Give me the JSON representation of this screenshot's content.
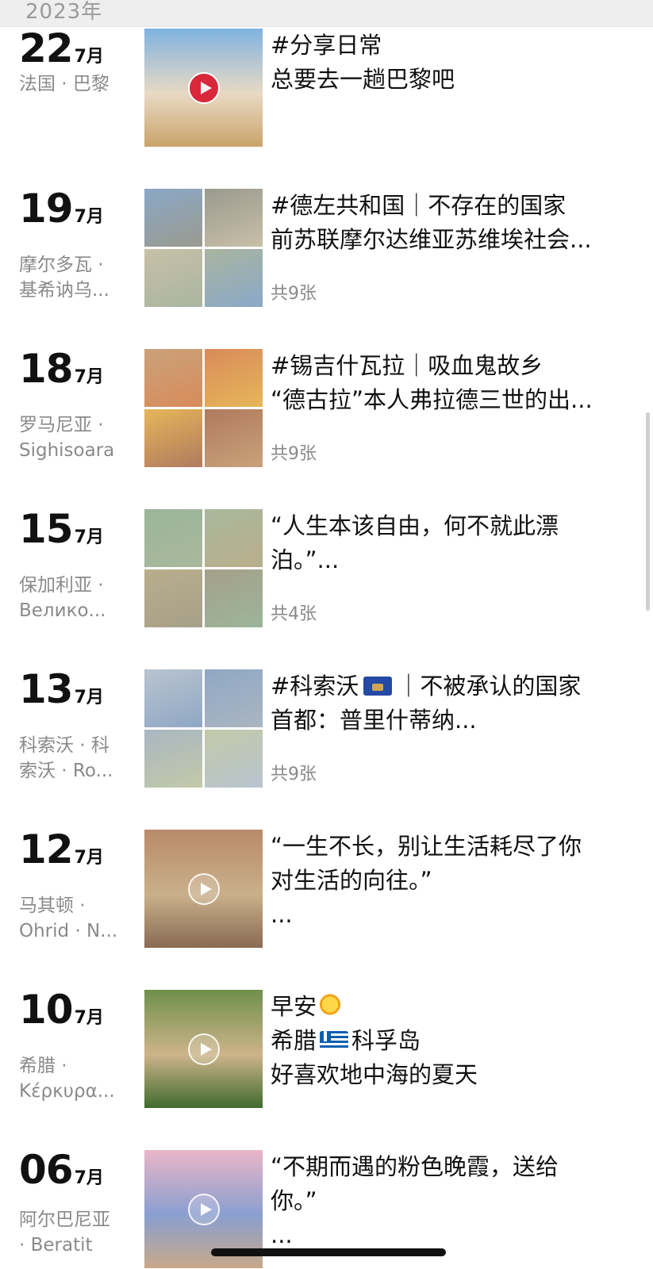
{
  "header": {
    "year": "2023年"
  },
  "entries": [
    {
      "day": "22",
      "month": "7月",
      "location": {
        "line1": "法国 · 巴黎",
        "line2": ""
      },
      "caption": [
        "#分享日常",
        "总要去一趟巴黎吧"
      ],
      "count": "",
      "media": "video",
      "colors": [
        "#7fb3e0",
        "#e9d9c4",
        "#c9a46a"
      ]
    },
    {
      "day": "19",
      "month": "7月",
      "location": {
        "line1": "摩尔多瓦 ·",
        "line2": "基希讷乌..."
      },
      "caption": [
        "#德左共和国｜不存在的国家",
        "前苏联摩尔达维亚苏维埃社会..."
      ],
      "count": "共9张",
      "media": "grid",
      "colors": [
        "#8aa8c8",
        "#9a9a8e",
        "#c8c0a8",
        "#a9b5a0"
      ]
    },
    {
      "day": "18",
      "month": "7月",
      "location": {
        "line1": "罗马尼亚 ·",
        "line2": "Sighisoara"
      },
      "caption": [
        "#锡吉什瓦拉｜吸血鬼故乡",
        "“德古拉”本人弗拉德三世的出..."
      ],
      "count": "共9张",
      "media": "grid",
      "colors": [
        "#c9a27a",
        "#d98b5a",
        "#e6b65a",
        "#b07a5e"
      ]
    },
    {
      "day": "15",
      "month": "7月",
      "location": {
        "line1": "保加利亚 ·",
        "line2": "Велико..."
      },
      "caption": [
        "“人生本该自由，何不就此漂",
        "泊。”..."
      ],
      "count": "共4张",
      "media": "grid",
      "colors": [
        "#9bb59a",
        "#a9b89c",
        "#b9ae8c",
        "#a6a08a"
      ]
    },
    {
      "day": "13",
      "month": "7月",
      "location": {
        "line1": "科索沃 · 科",
        "line2": "索沃 · Ro..."
      },
      "caption": [
        "#科索沃[flag-xk]｜不被承认的国家",
        "首都：普里什蒂纳..."
      ],
      "count": "共9张",
      "media": "grid",
      "colors": [
        "#b9c4cf",
        "#8fa7c4",
        "#aab6c2",
        "#c2c9a8"
      ]
    },
    {
      "day": "12",
      "month": "7月",
      "location": {
        "line1": "马其顿 ·",
        "line2": "Ohrid · N..."
      },
      "caption": [
        "“一生不长，别让生活耗尽了你",
        "对生活的向往。”",
        "..."
      ],
      "count": "",
      "media": "video",
      "colors": [
        "#b98a6a",
        "#c9b08a",
        "#8a6a54"
      ]
    },
    {
      "day": "10",
      "month": "7月",
      "location": {
        "line1": "希腊 ·",
        "line2": "Κέρκυρα..."
      },
      "caption": [
        "早安[sun]",
        "希腊[flag-gr]科孚岛",
        "好喜欢地中海的夏天"
      ],
      "count": "",
      "media": "video",
      "colors": [
        "#6f8f4c",
        "#cdb48a",
        "#3f6b2f"
      ]
    },
    {
      "day": "06",
      "month": "7月",
      "location": {
        "line1": "阿尔巴尼亚",
        "line2": "· Beratit"
      },
      "caption": [
        "“不期而遇的粉色晚霞，送给",
        "你。”",
        "..."
      ],
      "count": "",
      "media": "video",
      "colors": [
        "#e9b6c9",
        "#8a9fd0",
        "#c7a98a"
      ]
    }
  ],
  "icons": {
    "play": "play-icon",
    "flag_kosovo": "kosovo-flag-icon",
    "flag_greece": "greece-flag-icon",
    "sun": "sun-emoji-icon"
  }
}
